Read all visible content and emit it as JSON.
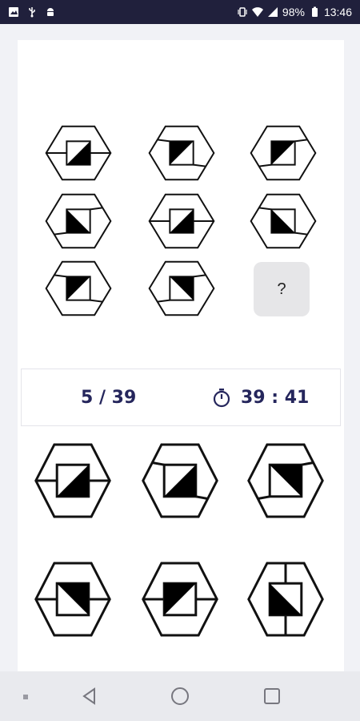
{
  "status_bar": {
    "battery": "98%",
    "time": "13:46",
    "icons": [
      "image-icon",
      "usb-icon",
      "android-debug-icon",
      "vibrate-icon",
      "wifi-icon",
      "signal-icon",
      "battery-icon"
    ]
  },
  "puzzle": {
    "missing_label": "?",
    "cells": [
      {
        "variant": "horizontal-line",
        "fill": "bottom-right"
      },
      {
        "variant": "diagonal-line",
        "fill": "top-left"
      },
      {
        "variant": "slash-line",
        "fill": "top-left"
      },
      {
        "variant": "slash-line",
        "fill": "bottom-left"
      },
      {
        "variant": "horizontal-line",
        "fill": "bottom-right"
      },
      {
        "variant": "diagonal-line",
        "fill": "bottom-left"
      },
      {
        "variant": "diagonal-line",
        "fill": "top-left"
      },
      {
        "variant": "slash-line",
        "fill": "top-right"
      }
    ]
  },
  "info": {
    "progress": "5 / 39",
    "timer": "39 : 41",
    "timer_icon": "stopwatch-icon"
  },
  "answers": [
    {
      "variant": "horizontal-line",
      "fill": "bottom-right"
    },
    {
      "variant": "diagonal-line",
      "fill": "bottom-right"
    },
    {
      "variant": "slash-line",
      "fill": "top-right"
    },
    {
      "variant": "horizontal-line",
      "fill": "top-right"
    },
    {
      "variant": "horizontal-line",
      "fill": "top-left"
    },
    {
      "variant": "vertical-line",
      "fill": "bottom-left"
    }
  ],
  "nav": {
    "icons": [
      "dot-icon",
      "back-icon",
      "home-icon",
      "recents-icon"
    ]
  }
}
